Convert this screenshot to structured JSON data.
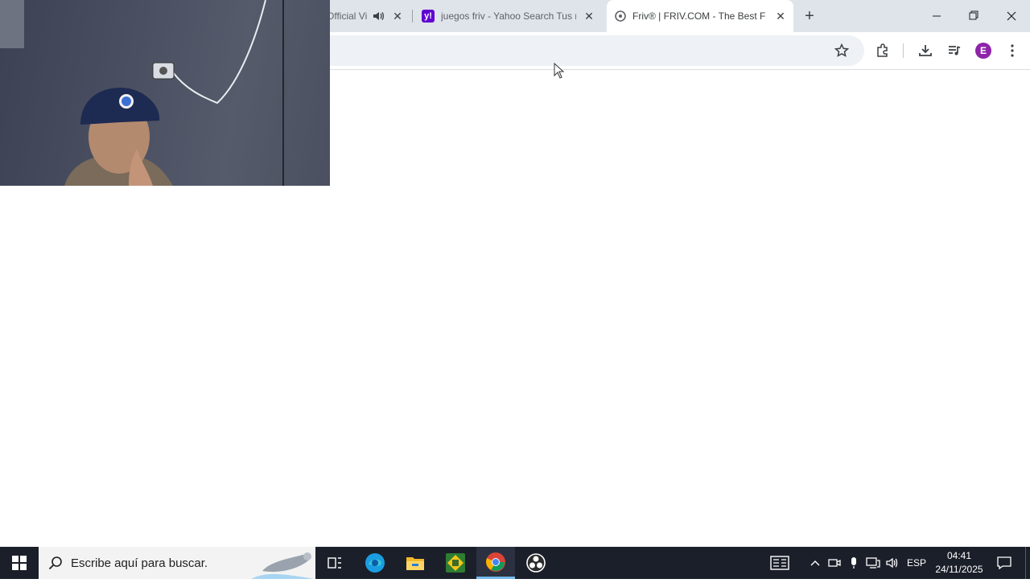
{
  "browser": {
    "tabs": [
      {
        "title": "Official Vi",
        "icon": "speaker-icon"
      },
      {
        "title": "juegos friv - Yahoo Search Tus r",
        "icon": "yahoo-favicon"
      },
      {
        "title": "Friv® | FRIV.COM - The Best Fre",
        "icon": "friv-favicon",
        "active": true
      }
    ],
    "new_tab_label": "+",
    "profile_initial": "E",
    "accent": "#8e24aa"
  },
  "taskbar": {
    "search_placeholder": "Escribe aquí para buscar.",
    "language": "ESP",
    "time": "04:41",
    "date": "24/11/2025",
    "pinned": [
      "task-view-icon",
      "edge-icon",
      "file-explorer-icon",
      "app-icon",
      "chrome-icon",
      "obs-icon"
    ]
  }
}
